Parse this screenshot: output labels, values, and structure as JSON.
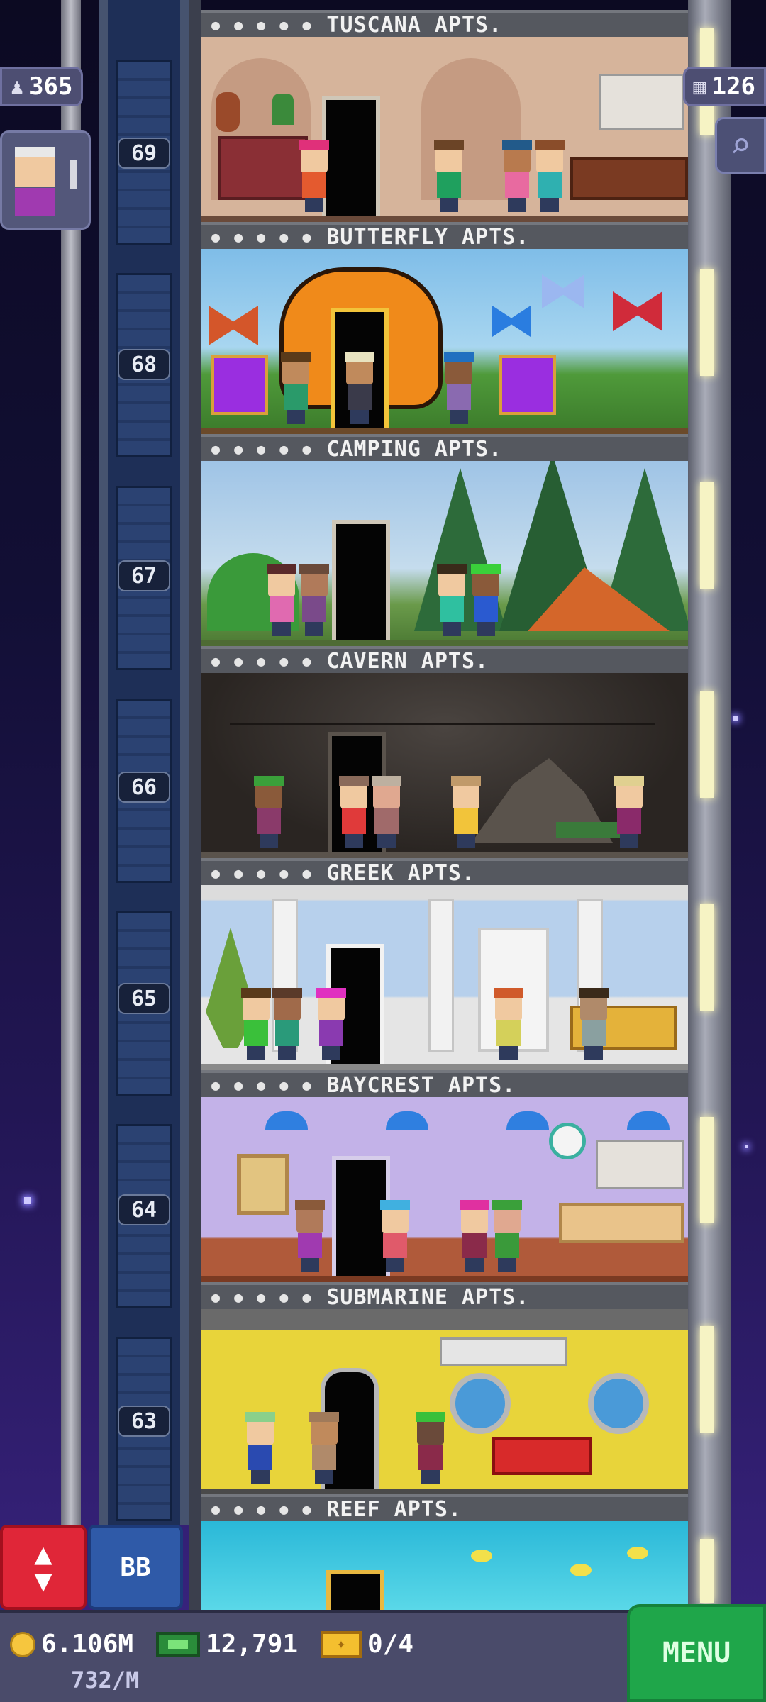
{
  "hud": {
    "population": "365",
    "floors_count": "126"
  },
  "floors": [
    {
      "name": "TUSCANA APTS.",
      "number": "69",
      "theme": "tuscan-apartment"
    },
    {
      "name": "BUTTERFLY APTS.",
      "number": "68",
      "theme": "butterfly-garden"
    },
    {
      "name": "CAMPING APTS.",
      "number": "67",
      "theme": "forest-campsite"
    },
    {
      "name": "CAVERN APTS.",
      "number": "66",
      "theme": "cave"
    },
    {
      "name": "GREEK APTS.",
      "number": "65",
      "theme": "greek-columns"
    },
    {
      "name": "BAYCREST APTS.",
      "number": "64",
      "theme": "lavender-kitchen"
    },
    {
      "name": "SUBMARINE APTS.",
      "number": "63",
      "theme": "submarine-interior"
    },
    {
      "name": "REEF APTS.",
      "number": "",
      "theme": "aquarium-reef"
    }
  ],
  "controls": {
    "elevator_icon": "up-down-arrows-icon",
    "bb_label": "BB",
    "menu_label": "MENU"
  },
  "resources": {
    "coins": "6.106M",
    "bux": "12,791",
    "tickets": "0/4",
    "income_rate": "732/M"
  },
  "colors": {
    "sky_top": "#0c0a22",
    "sky_bottom": "#3b2483",
    "elevator_button": "#e02638",
    "bb_button": "#2f5aa8",
    "menu_button": "#1fa64a",
    "coin": "#f6c63e",
    "bux": "#2a8c3a",
    "ticket": "#f4bf2f"
  }
}
